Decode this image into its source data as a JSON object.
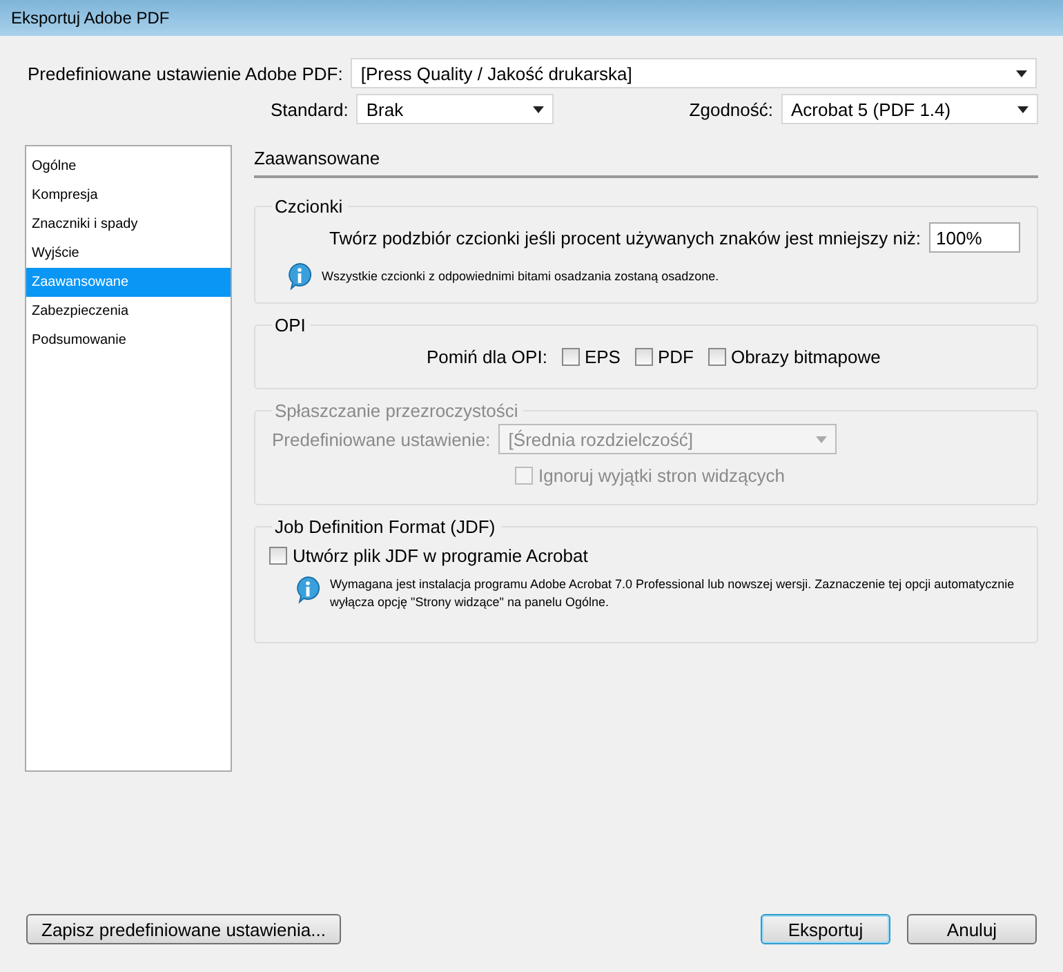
{
  "window": {
    "title": "Eksportuj Adobe PDF"
  },
  "preset": {
    "label": "Predefiniowane ustawienie Adobe PDF:",
    "value": "[Press Quality / Jakość drukarska]"
  },
  "standard": {
    "label": "Standard:",
    "value": "Brak"
  },
  "compatibility": {
    "label": "Zgodność:",
    "value": "Acrobat 5 (PDF 1.4)"
  },
  "sidebar": {
    "items": [
      {
        "label": "Ogólne",
        "selected": false
      },
      {
        "label": "Kompresja",
        "selected": false
      },
      {
        "label": "Znaczniki i spady",
        "selected": false
      },
      {
        "label": "Wyjście",
        "selected": false
      },
      {
        "label": "Zaawansowane",
        "selected": true
      },
      {
        "label": "Zabezpieczenia",
        "selected": false
      },
      {
        "label": "Podsumowanie",
        "selected": false
      }
    ]
  },
  "panel": {
    "title": "Zaawansowane"
  },
  "fonts_group": {
    "title": "Czcionki",
    "label": "Twórz podzbiór czcionki jeśli procent używanych znaków jest mniejszy niż:",
    "value": "100%",
    "info": "Wszystkie czcionki z odpowiednimi bitami osadzania zostaną osadzone."
  },
  "opi_group": {
    "title": "OPI",
    "label": "Pomiń dla OPI:",
    "options": [
      {
        "label": "EPS",
        "checked": false
      },
      {
        "label": "PDF",
        "checked": false
      },
      {
        "label": "Obrazy bitmapowe",
        "checked": false
      }
    ]
  },
  "flattener_group": {
    "title": "Spłaszczanie przezroczystości",
    "disabled": true,
    "preset_label": "Predefiniowane ustawienie:",
    "preset_value": "[Średnia rozdzielczość]",
    "checkbox": {
      "label": "Ignoruj wyjątki stron widzących",
      "checked": false
    }
  },
  "jdf_group": {
    "title": "Job Definition Format (JDF)",
    "checkbox": {
      "label": "Utwórz plik JDF w programie Acrobat",
      "checked": false
    },
    "info": "Wymagana jest instalacja programu Adobe Acrobat 7.0 Professional lub nowszej wersji. Zaznaczenie tej opcji automatycznie wyłącza opcję \"Strony widzące\" na panelu Ogólne."
  },
  "save_button": {
    "label": "Zapisz predefiniowane ustawienia..."
  },
  "buttons": [
    {
      "label": "Eksportuj",
      "default": true
    },
    {
      "label": "Anuluj",
      "default": false
    }
  ]
}
